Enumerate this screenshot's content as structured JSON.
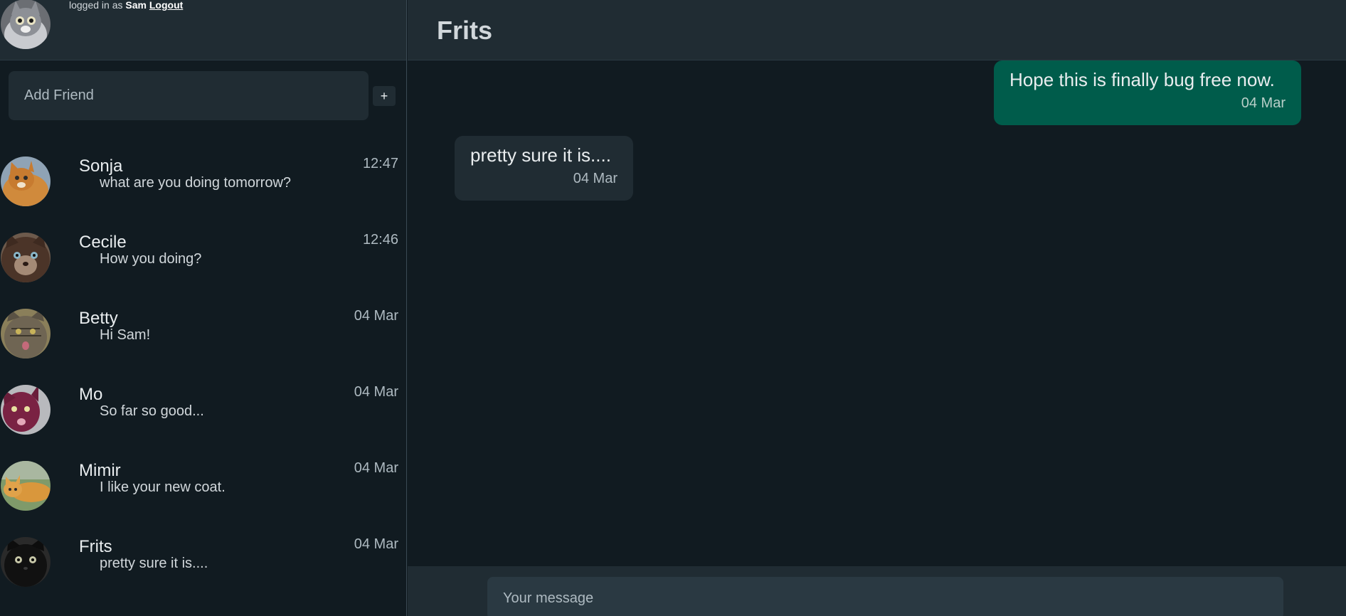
{
  "user": {
    "logged_in_prefix": "logged in as",
    "username": "Sam",
    "logout_label": "Logout",
    "avatar_icon": "cat-avatar-icon"
  },
  "sidebar": {
    "add_friend_placeholder": "Add Friend",
    "add_friend_button_label": "+",
    "contacts": [
      {
        "name": "Sonja",
        "preview": "what are you doing tomorrow?",
        "time": "12:47"
      },
      {
        "name": "Cecile",
        "preview": "How you doing?",
        "time": "12:46"
      },
      {
        "name": "Betty",
        "preview": "Hi Sam!",
        "time": "04 Mar"
      },
      {
        "name": "Mo",
        "preview": "So far so good...",
        "time": "04 Mar"
      },
      {
        "name": "Mimir",
        "preview": "I like your new coat.",
        "time": "04 Mar"
      },
      {
        "name": "Frits",
        "preview": "pretty sure it is....",
        "time": "04 Mar"
      }
    ]
  },
  "chat": {
    "title": "Frits",
    "messages": [
      {
        "direction": "outgoing",
        "text": "Hope this is finally bug free now.",
        "date": "04 Mar"
      },
      {
        "direction": "incoming",
        "text": "pretty sure it is....",
        "date": "04 Mar"
      }
    ],
    "message_placeholder": "Your message"
  },
  "colors": {
    "background": "#111b21",
    "panel": "#202c33",
    "outgoing_bubble": "#005c4b",
    "incoming_bubble": "#202c33",
    "text_primary": "#e9edef",
    "text_secondary": "#aebac1"
  }
}
